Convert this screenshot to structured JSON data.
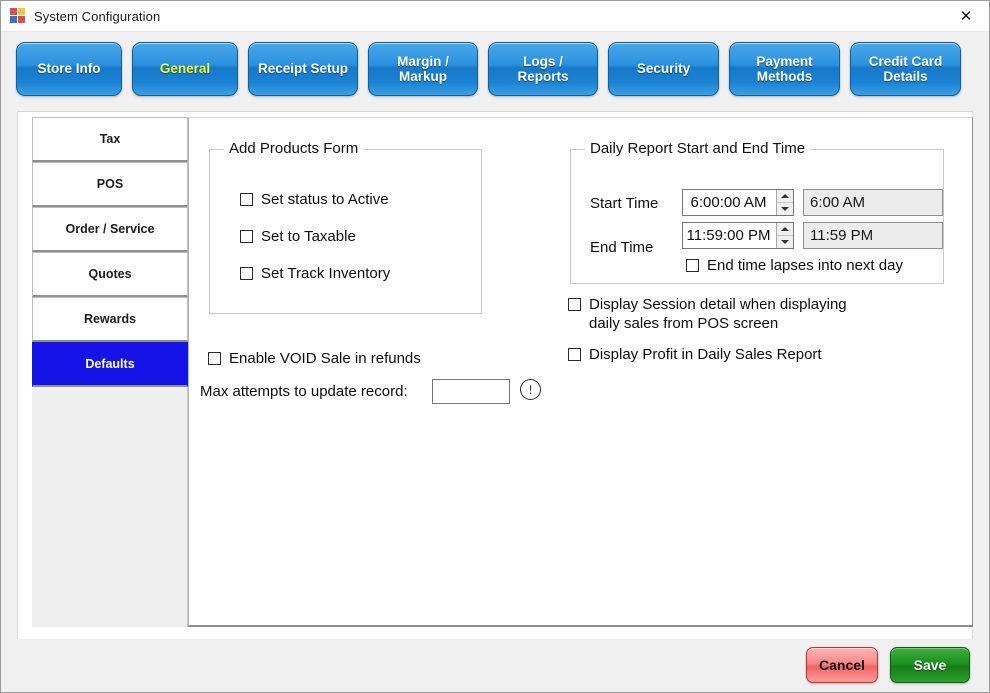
{
  "window": {
    "title": "System Configuration",
    "icon": "app-grid-icon",
    "close_label": "✕"
  },
  "tabs": [
    {
      "label": "Store Info",
      "active": false,
      "width": "w1"
    },
    {
      "label": "General",
      "active": true,
      "width": "w1"
    },
    {
      "label": "Receipt Setup",
      "active": false,
      "width": "w2"
    },
    {
      "label": "Margin /\nMarkup",
      "active": false,
      "width": "w2"
    },
    {
      "label": "Logs /\nReports",
      "active": false,
      "width": "w2"
    },
    {
      "label": "Security",
      "active": false,
      "width": "w3"
    },
    {
      "label": "Payment\nMethods",
      "active": false,
      "width": "w3"
    },
    {
      "label": "Credit Card\nDetails",
      "active": false,
      "width": "w3"
    }
  ],
  "sidebar": {
    "items": [
      {
        "label": "Tax",
        "selected": false
      },
      {
        "label": "POS",
        "selected": false
      },
      {
        "label": "Order / Service",
        "selected": false
      },
      {
        "label": "Quotes",
        "selected": false
      },
      {
        "label": "Rewards",
        "selected": false
      },
      {
        "label": "Defaults",
        "selected": true
      }
    ]
  },
  "add_products_form": {
    "title": "Add Products Form",
    "checkboxes": [
      {
        "label": "Set status to Active",
        "checked": false
      },
      {
        "label": "Set to Taxable",
        "checked": false
      },
      {
        "label": "Set Track Inventory",
        "checked": false
      }
    ]
  },
  "void_sale": {
    "label": "Enable VOID Sale in refunds",
    "checked": false
  },
  "max_attempts": {
    "label": "Max attempts to update record:",
    "value": "",
    "placeholder": "",
    "info_icon": "exclamation-circle-icon",
    "info_glyph": "!"
  },
  "daily_report": {
    "title": "Daily Report Start and End Time",
    "start": {
      "label": "Start Time",
      "spinner_value": "6:00:00 AM",
      "readonly_value": "6:00 AM"
    },
    "end": {
      "label": "End Time",
      "spinner_value": "11:59:00 PM",
      "readonly_value": "11:59 PM"
    },
    "lapse_checkbox": {
      "label": "End time lapses into next day",
      "checked": false
    }
  },
  "display_options": [
    {
      "label": "Display Session detail when displaying\ndaily sales from POS screen",
      "checked": false
    },
    {
      "label": "Display Profit in Daily Sales Report",
      "checked": false
    }
  ],
  "footer": {
    "cancel_label": "Cancel",
    "save_label": "Save"
  },
  "colors": {
    "tab_blue": "#1878c8",
    "tab_active_text": "#f3ff2e",
    "sidebar_selected": "#1414e6",
    "save_green": "#1f9120",
    "cancel_red": "#f06464"
  }
}
